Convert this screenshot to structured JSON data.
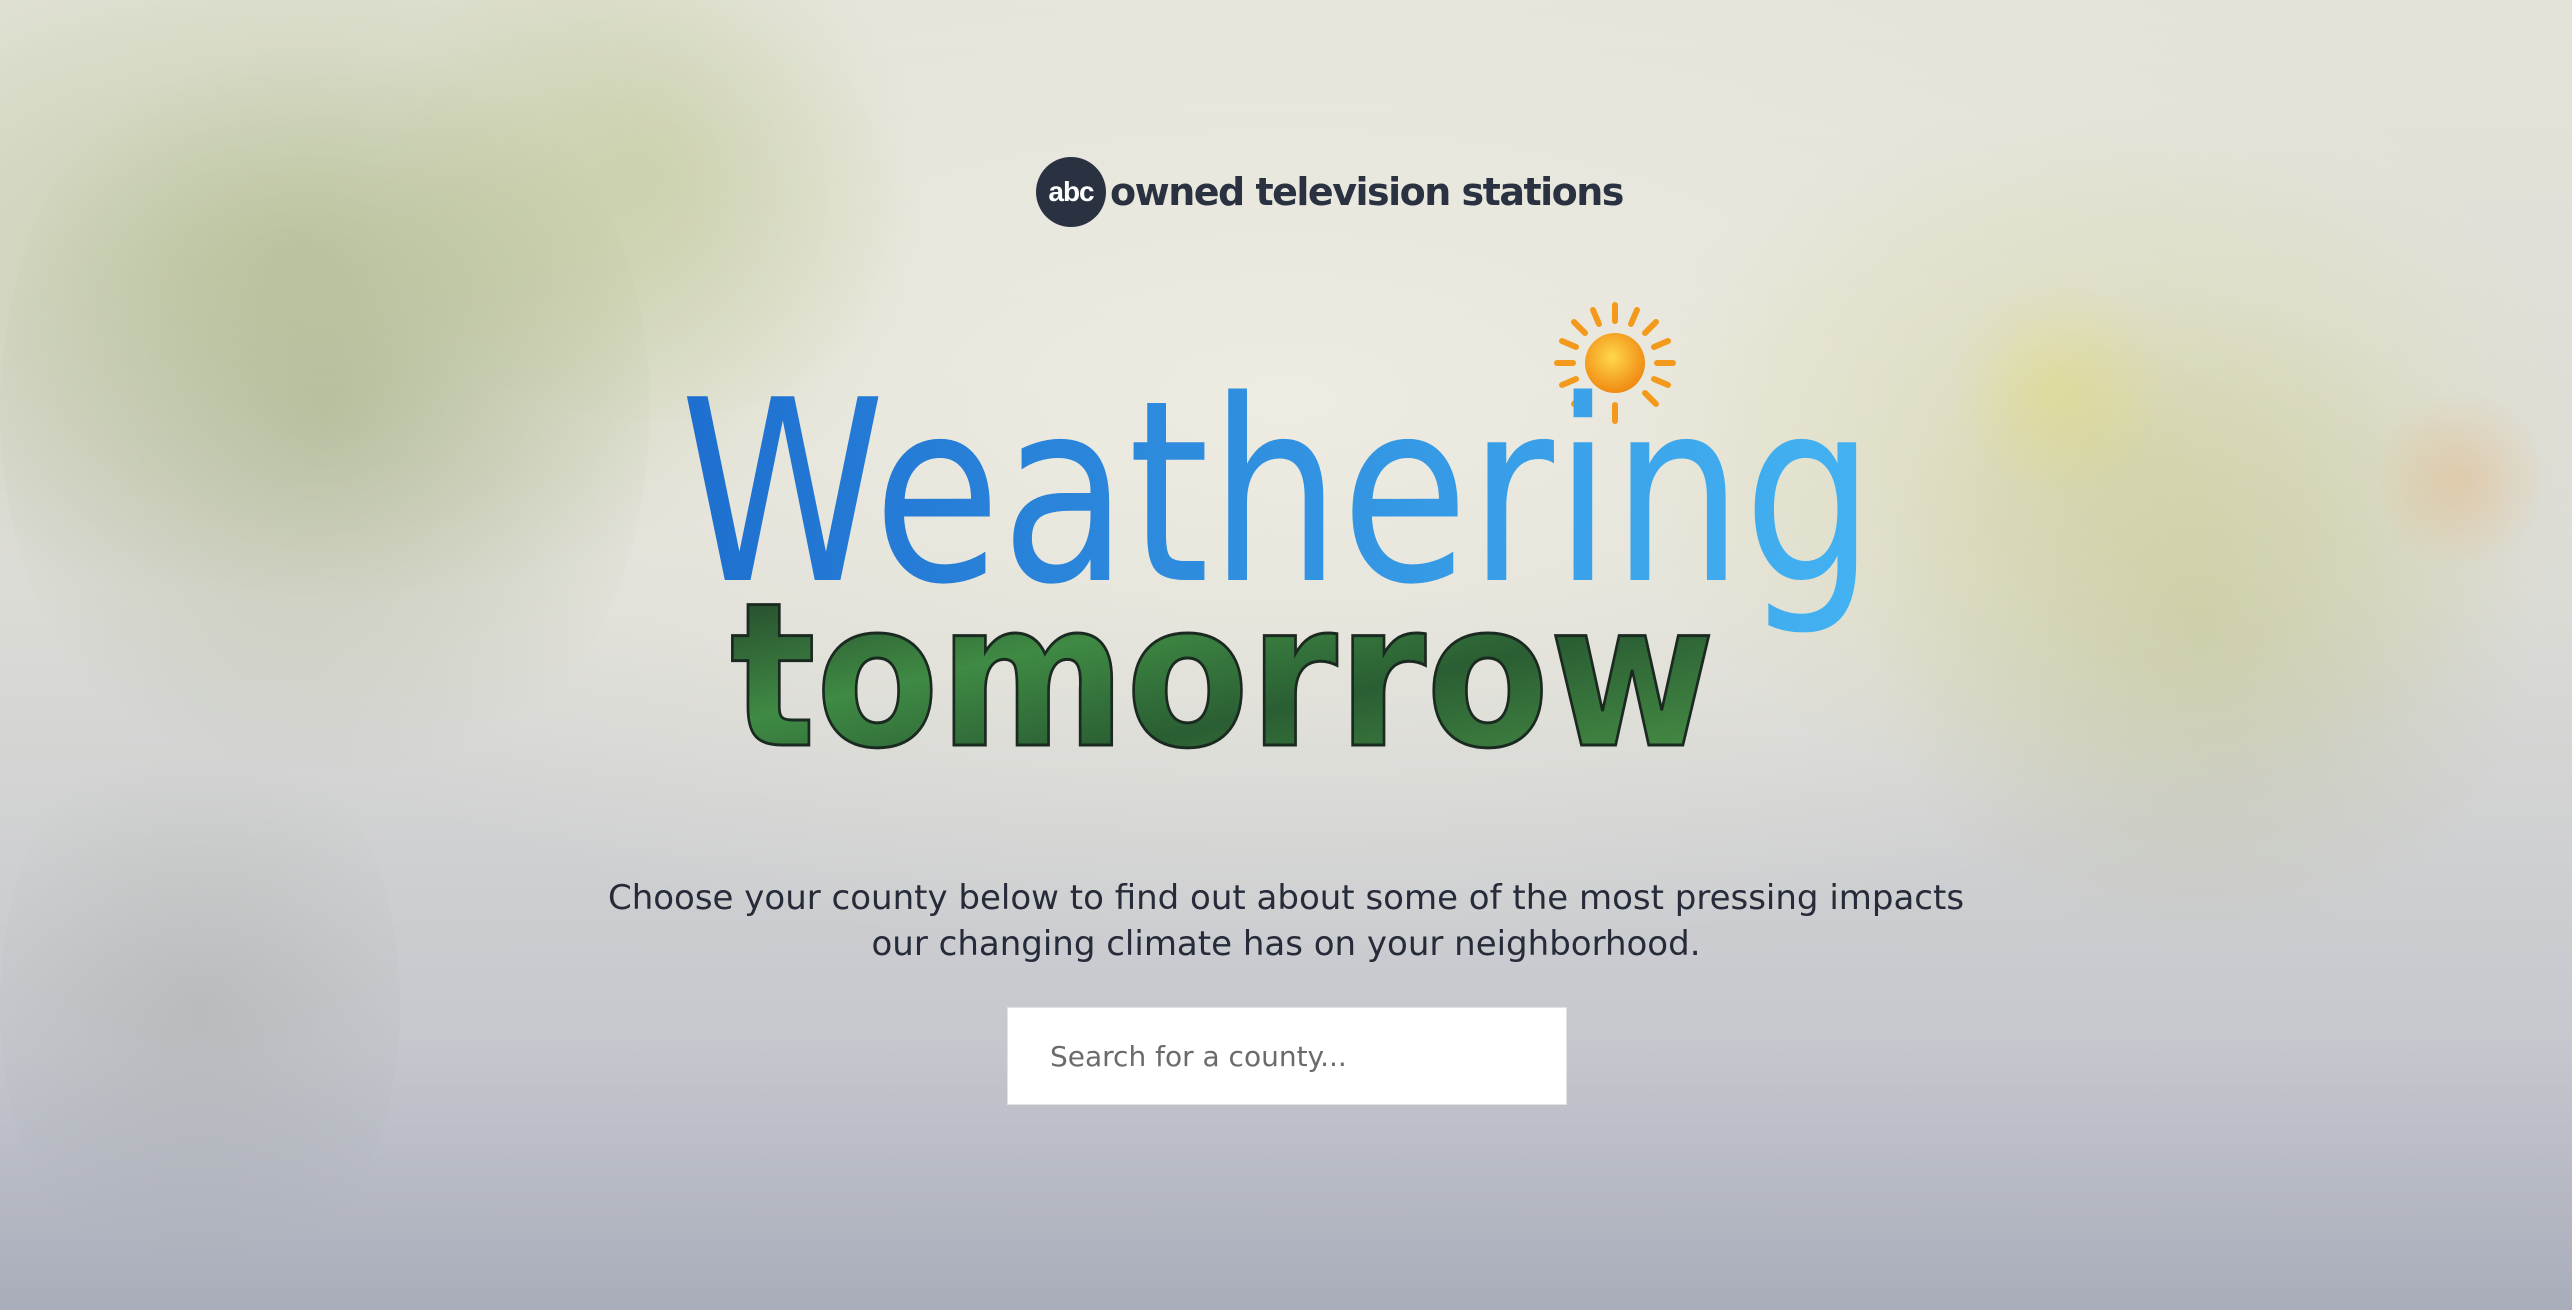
{
  "brand": {
    "icon_text": "abc",
    "name": "owned television stations"
  },
  "hero": {
    "title_line1": "Weathering",
    "title_line2": "tomorrow",
    "sun_icon": "sun-icon"
  },
  "intro": {
    "line1": "Choose your county below to find out about some of the most pressing impacts",
    "line2": "our changing climate has on your neighborhood."
  },
  "search": {
    "placeholder": "Search for a county...",
    "value": ""
  },
  "colors": {
    "brand_dark": "#2a3241",
    "title_blue_start": "#1e6fcf",
    "title_blue_end": "#44b3f2",
    "title_green": "#2f6b3a",
    "sun": "#f2a21c"
  }
}
